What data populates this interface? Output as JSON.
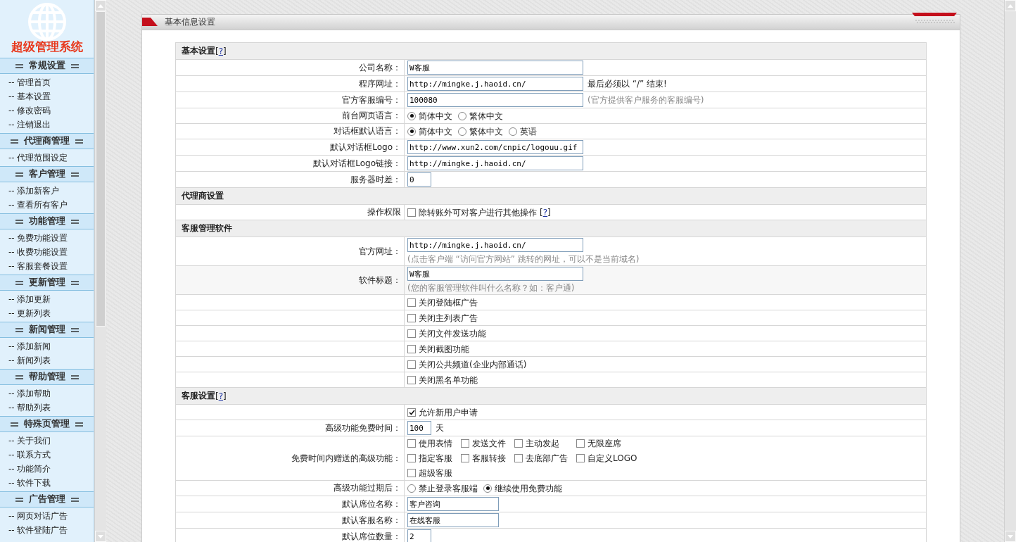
{
  "sidebar": {
    "title": "超级管理系统",
    "groups": [
      {
        "title": "常规设置",
        "items": [
          "-- 管理首页",
          "-- 基本设置",
          "-- 修改密码",
          "-- 注销退出"
        ]
      },
      {
        "title": "代理商管理",
        "items": [
          "-- 代理范围设定"
        ]
      },
      {
        "title": "客户管理",
        "items": [
          "-- 添加新客户",
          "-- 查看所有客户"
        ]
      },
      {
        "title": "功能管理",
        "items": [
          "-- 免费功能设置",
          "-- 收费功能设置",
          "-- 客服套餐设置"
        ]
      },
      {
        "title": "更新管理",
        "items": [
          "-- 添加更新",
          "-- 更新列表"
        ]
      },
      {
        "title": "新闻管理",
        "items": [
          "-- 添加新闻",
          "-- 新闻列表"
        ]
      },
      {
        "title": "帮助管理",
        "items": [
          "-- 添加帮助",
          "-- 帮助列表"
        ]
      },
      {
        "title": "特殊页管理",
        "items": [
          "-- 关于我们",
          "-- 联系方式",
          "-- 功能简介",
          "-- 软件下载"
        ]
      },
      {
        "title": "广告管理",
        "items": [
          "-- 网页对话广告",
          "-- 软件登陆广告"
        ]
      }
    ]
  },
  "panel": {
    "title": "基本信息设置"
  },
  "sections": [
    {
      "title": "基本设置",
      "help": {
        "open": "[",
        "link": "?",
        "close": "]"
      },
      "rows": [
        {
          "kind": "text",
          "label": "公司名称：",
          "value": "W客服"
        },
        {
          "kind": "text",
          "label": "程序网址：",
          "value": "http://mingke.j.haoid.cn/",
          "suffix": "最后必须以 “/” 结束!"
        },
        {
          "kind": "text",
          "label": "官方客服编号：",
          "value": "100080",
          "note": "(官方提供客户服务的客服编号)"
        },
        {
          "kind": "radio",
          "label": "前台网页语言：",
          "options": [
            {
              "label": "简体中文",
              "selected": true
            },
            {
              "label": "繁体中文",
              "selected": false
            }
          ]
        },
        {
          "kind": "radio",
          "label": "对话框默认语言：",
          "options": [
            {
              "label": "简体中文",
              "selected": true
            },
            {
              "label": "繁体中文",
              "selected": false
            },
            {
              "label": "英语",
              "selected": false
            }
          ]
        },
        {
          "kind": "text",
          "label": "默认对话框Logo：",
          "value": "http://www.xun2.com/cnpic/logouu.gif"
        },
        {
          "kind": "text",
          "label": "默认对话框Logo链接：",
          "value": "http://mingke.j.haoid.cn/"
        },
        {
          "kind": "number",
          "label": "服务器时差：",
          "value": "0"
        }
      ]
    },
    {
      "title": "代理商设置",
      "rows": [
        {
          "kind": "check",
          "label": "操作权限",
          "options": [
            {
              "label": "除转账外可对客户进行其他操作",
              "checked": false,
              "help": {
                "open": "[",
                "link": "?",
                "close": "]"
              }
            }
          ]
        }
      ]
    },
    {
      "title": "客服管理软件",
      "rows": [
        {
          "kind": "text",
          "label": "官方网址：",
          "value": "http://mingke.j.haoid.cn/",
          "hint": "(点击客户端 “访问官方网站” 跳转的网址，可以不是当前域名)"
        },
        {
          "kind": "text",
          "label": "软件标题：",
          "value": "W客服",
          "hint": "(您的客服管理软件叫什么名称？如：客户通)",
          "shaded": true
        },
        {
          "kind": "check",
          "options": [
            {
              "label": "关闭登陆框广告",
              "checked": false
            }
          ]
        },
        {
          "kind": "check",
          "options": [
            {
              "label": "关闭主列表广告",
              "checked": false
            }
          ]
        },
        {
          "kind": "check",
          "options": [
            {
              "label": "关闭文件发送功能",
              "checked": false
            }
          ]
        },
        {
          "kind": "check",
          "options": [
            {
              "label": "关闭截图功能",
              "checked": false
            }
          ]
        },
        {
          "kind": "check",
          "options": [
            {
              "label": "关闭公共频道(企业内部通话)",
              "checked": false
            }
          ]
        },
        {
          "kind": "check",
          "options": [
            {
              "label": "关闭黑名单功能",
              "checked": false
            }
          ]
        }
      ]
    },
    {
      "title": "客服设置",
      "help": {
        "open": "[",
        "link": "?",
        "close": "]"
      },
      "rows": [
        {
          "kind": "check",
          "options": [
            {
              "label": "允许新用户申请",
              "checked": true
            }
          ]
        },
        {
          "kind": "number",
          "label": "高级功能免费时间：",
          "value": "100",
          "suffix": "天"
        },
        {
          "kind": "check",
          "label": "免费时间内赠送的高级功能：",
          "grid": true,
          "options": [
            {
              "label": "使用表情",
              "checked": false
            },
            {
              "label": "发送文件",
              "checked": false
            },
            {
              "label": "主动发起",
              "checked": false
            },
            {
              "label": "无限座席",
              "checked": false
            },
            {
              "label": "指定客服",
              "checked": false
            },
            {
              "label": "客服转接",
              "checked": false
            },
            {
              "label": "去底部广告",
              "checked": false
            },
            {
              "label": "自定义LOGO",
              "checked": false
            },
            {
              "label": "超级客服",
              "checked": false
            }
          ]
        },
        {
          "kind": "radio",
          "label": "高级功能过期后：",
          "options": [
            {
              "label": "禁止登录客服端",
              "selected": false
            },
            {
              "label": "继续使用免费功能",
              "selected": true
            }
          ]
        },
        {
          "kind": "short_text",
          "label": "默认席位名称：",
          "value": "客户咨询"
        },
        {
          "kind": "short_text",
          "label": "默认客服名称：",
          "value": "在线客服"
        },
        {
          "kind": "number",
          "label": "默认席位数量：",
          "value": "2"
        }
      ]
    }
  ]
}
